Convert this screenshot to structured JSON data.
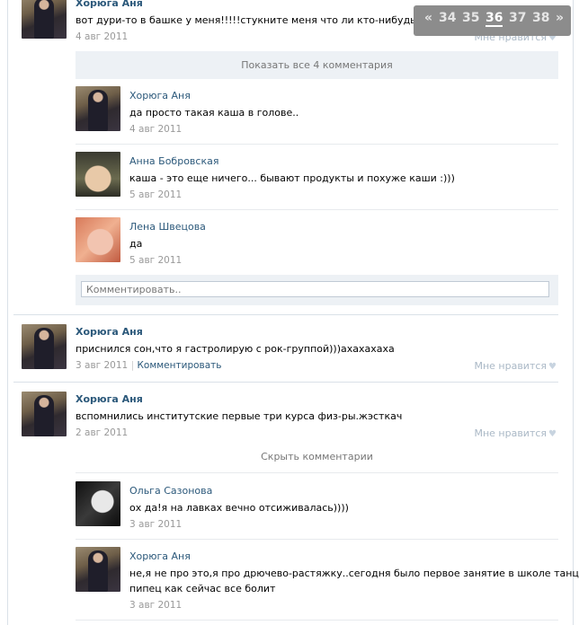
{
  "top_post": {
    "author": "Хорюга Аня",
    "text": "вот дури-то в башке у меня!!!!!стукните меня что ли кто-нибудь!!",
    "date": "4 авг 2011",
    "like_label": "Мне нравится"
  },
  "show_all_comments": "Показать все 4 комментария",
  "comments_1": [
    {
      "author": "Хорюга Аня",
      "text": "да просто такая каша в голове..",
      "date": "4 авг 2011",
      "avatar": "dark"
    },
    {
      "author": "Анна Бобровская",
      "text": "каша - это еще ничего... бывают продукты и похуже каши :)))",
      "date": "5 авг 2011",
      "avatar": "blonde"
    },
    {
      "author": "Лена Швецова",
      "text": "да",
      "date": "5 авг 2011",
      "avatar": "red"
    }
  ],
  "comment_placeholder": "Комментировать..",
  "post_2": {
    "author": "Хорюга Аня",
    "text": "приснился сон,что я гастролирую с рок-группой)))ахахахаха",
    "date": "3 авг 2011",
    "comment_link": "Комментировать",
    "like_label": "Мне нравится"
  },
  "post_3": {
    "author": "Хорюга Аня",
    "text": "вспомнились институтские первые три курса физ-ры.жэсткач",
    "date": "2 авг 2011",
    "like_label": "Мне нравится"
  },
  "hide_comments": "Скрыть комментарии",
  "comments_3": [
    {
      "author": "Ольга Сазонова",
      "text": "ох да!я на лавках вечно отсиживалась))))",
      "date": "3 авг 2011",
      "avatar": "bw"
    },
    {
      "author": "Хорюга Аня",
      "text_line1": "не,я не про это,я про дрючево-растяжку..сегодня было первое занятие в школе танцев-",
      "text_line2": "пипец как сейчас все болит",
      "date": "3 авг 2011",
      "avatar": "dark"
    }
  ],
  "pager": {
    "prev": "«",
    "pages": [
      "34",
      "35",
      "36",
      "37",
      "38"
    ],
    "current": "36",
    "next": "»"
  },
  "colors": {
    "link": "#2b587a",
    "date": "#999999",
    "panel": "#edf1f5",
    "pager_bg": "#8c8c8c"
  },
  "icons": {
    "like": "heart-icon"
  }
}
